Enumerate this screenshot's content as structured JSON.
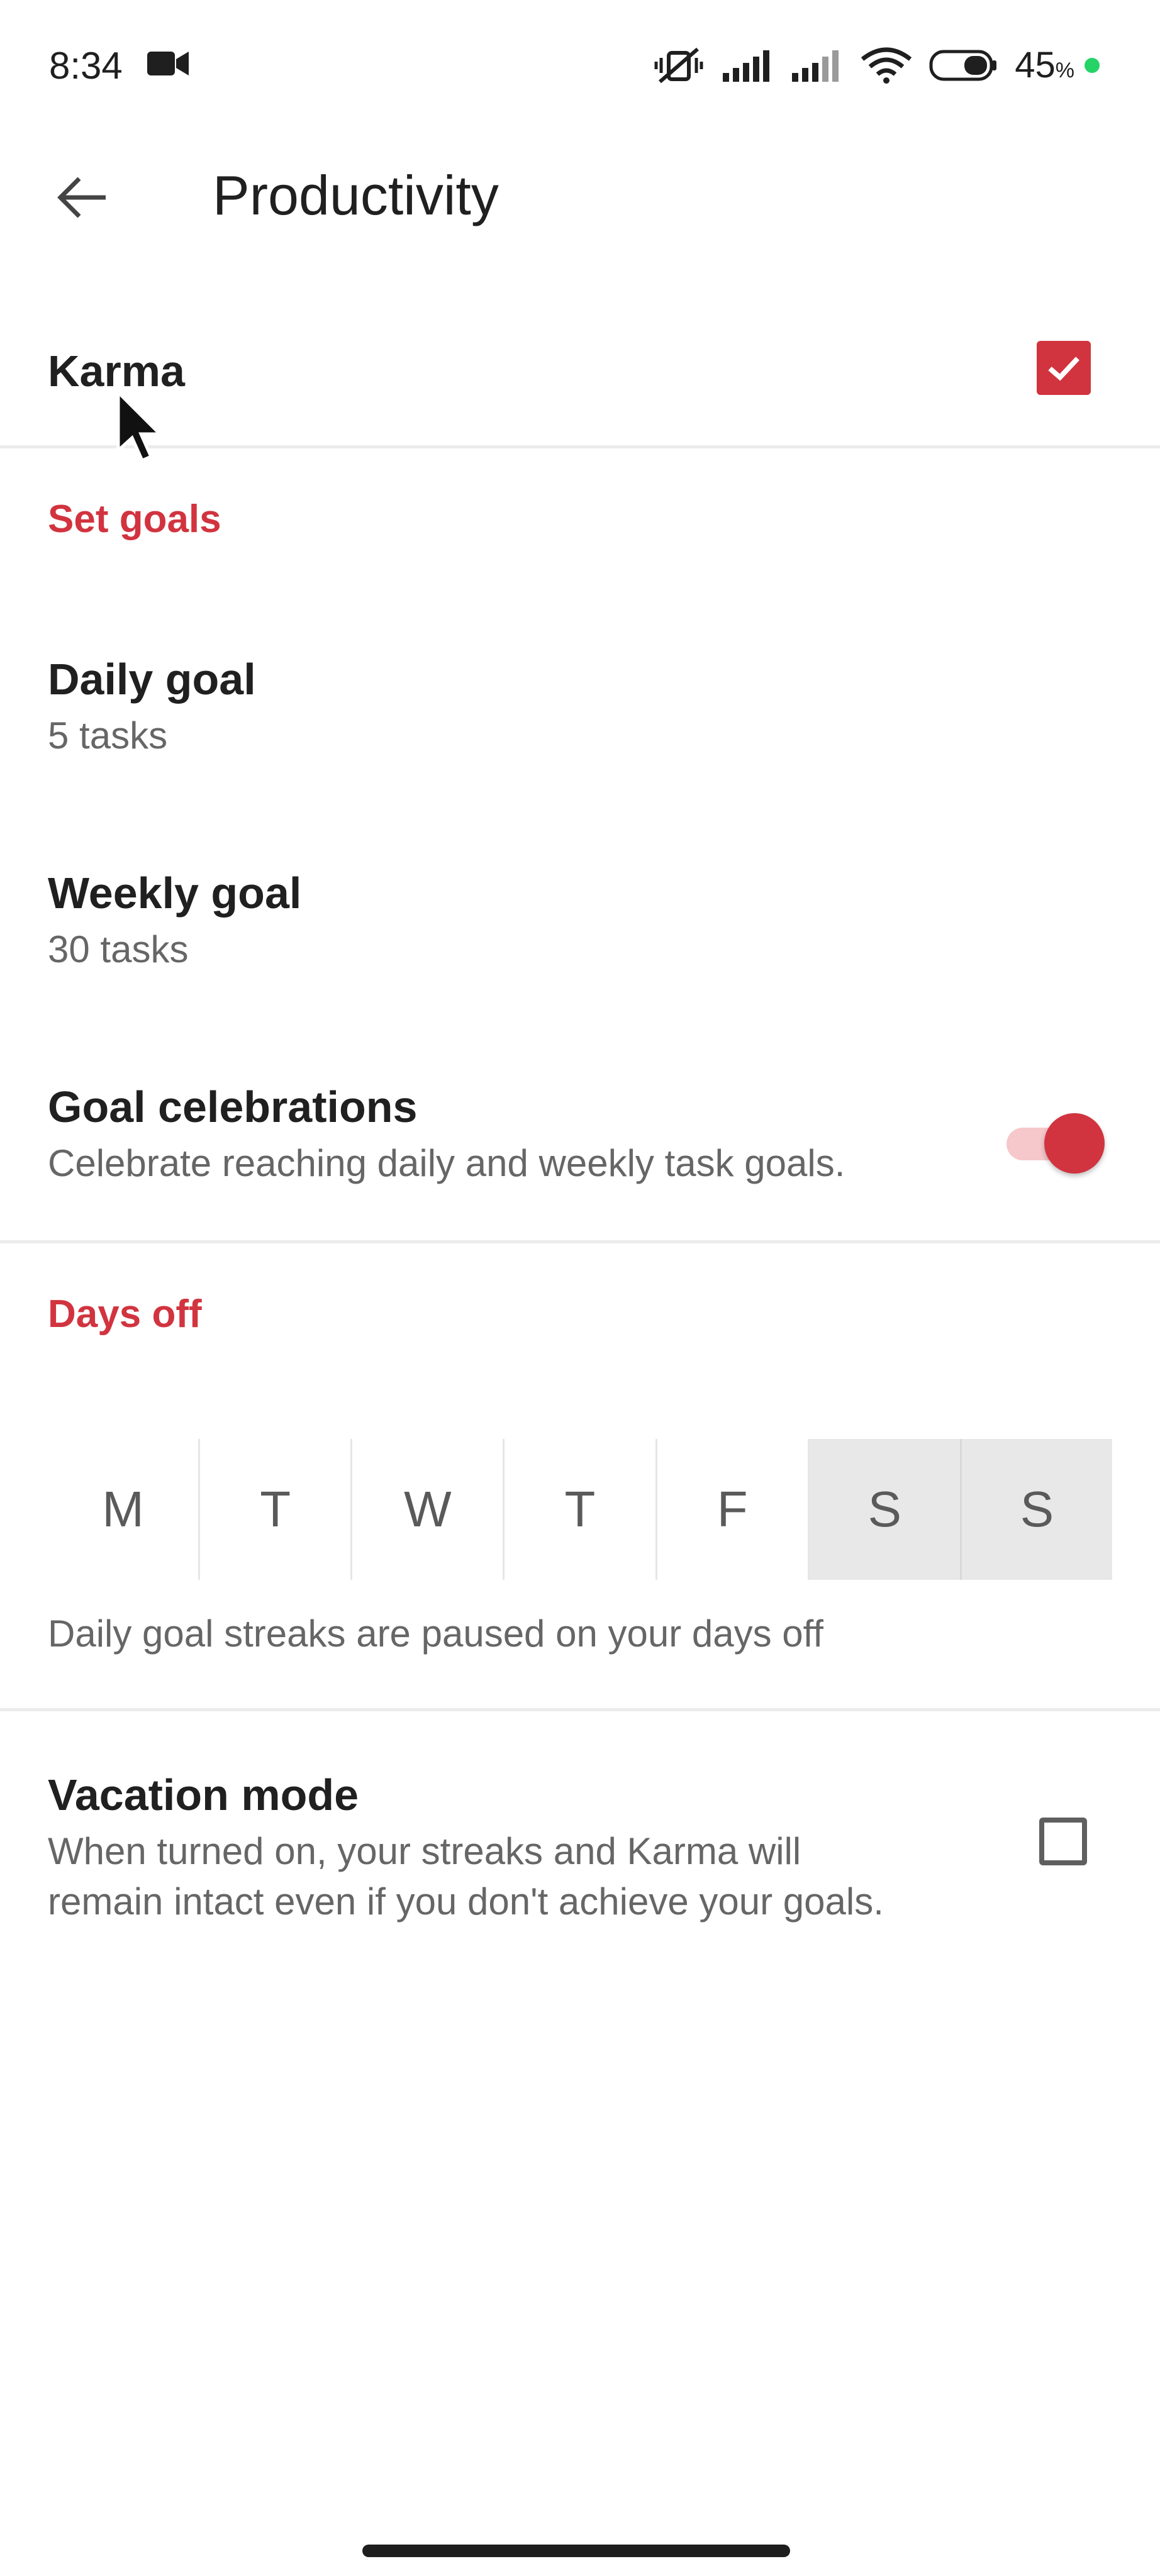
{
  "status_bar": {
    "time": "8:34",
    "battery_percent": "45",
    "battery_suffix": "%",
    "icons": [
      "video-camera-icon",
      "vibrate-off-icon",
      "signal-icon",
      "signal-icon",
      "wifi-icon",
      "battery-icon",
      "charging-dot-icon"
    ]
  },
  "app_bar": {
    "title": "Productivity",
    "back_icon": "arrow-left-icon"
  },
  "karma": {
    "label": "Karma",
    "checked": true
  },
  "set_goals": {
    "header": "Set goals",
    "daily_goal": {
      "title": "Daily goal",
      "value": "5 tasks"
    },
    "weekly_goal": {
      "title": "Weekly goal",
      "value": "30 tasks"
    },
    "goal_celebrations": {
      "title": "Goal celebrations",
      "description": "Celebrate reaching daily and weekly task goals.",
      "enabled": true
    }
  },
  "days_off": {
    "header": "Days off",
    "days": [
      {
        "label": "M",
        "selected": false
      },
      {
        "label": "T",
        "selected": false
      },
      {
        "label": "W",
        "selected": false
      },
      {
        "label": "T",
        "selected": false
      },
      {
        "label": "F",
        "selected": false
      },
      {
        "label": "S",
        "selected": true
      },
      {
        "label": "S",
        "selected": true
      }
    ],
    "note": "Daily goal streaks are paused on your days off"
  },
  "vacation_mode": {
    "title": "Vacation mode",
    "description_line1": "When turned on, your streaks and Karma will",
    "description_line2": "remain intact even if you don't achieve your goals.",
    "checked": false
  },
  "colors": {
    "accent": "#d1343f",
    "toggle_track": "#f6c7cb",
    "selected_day_bg": "#e8e8e8"
  }
}
